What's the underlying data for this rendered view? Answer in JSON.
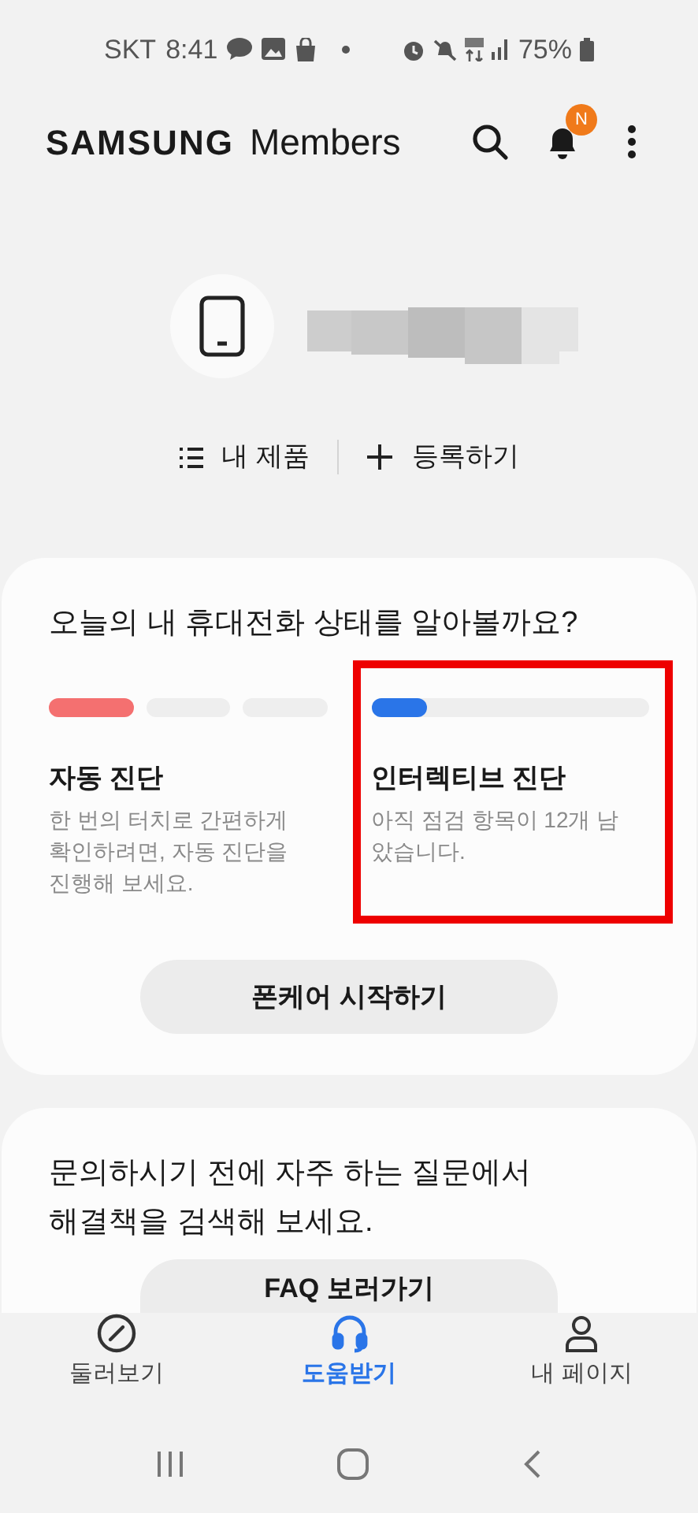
{
  "status_bar": {
    "carrier": "SKT",
    "time": "8:41",
    "battery": "75%"
  },
  "header": {
    "brand": "SAMSUNG",
    "title": "Members",
    "notification_badge": "N"
  },
  "profile_actions": [
    {
      "kind": "list",
      "label": "내 제품"
    },
    {
      "kind": "add",
      "label": "등록하기"
    }
  ],
  "diagnosis_card": {
    "question": "오늘의 내 휴대전화 상태를 알아볼까요?",
    "items": [
      {
        "kind": "segments",
        "title": "자동 진단",
        "description": "한 번의 터치로 간편하게 확인하려면, 자동 진단을 진행해 보세요.",
        "color": "#f47070",
        "segments": [
          {
            "done": true
          },
          {
            "done": false
          },
          {
            "done": false
          }
        ],
        "highlighted": false
      },
      {
        "kind": "bar",
        "title": "인터렉티브 진단",
        "description": "아직 점검 항목이 12개 남았습니다.",
        "color": "#2a75e8",
        "level": 0.2,
        "highlighted": true
      }
    ],
    "button": "폰케어 시작하기"
  },
  "faq_card": {
    "text": "문의하시기 전에 자주 하는 질문에서 해결책을 검색해 보세요.",
    "button": "FAQ 보러가기"
  },
  "bottom_nav": [
    {
      "kind": "explore",
      "label": "둘러보기",
      "selected": false
    },
    {
      "kind": "help",
      "label": "도움받기",
      "selected": true
    },
    {
      "kind": "profile",
      "label": "내 페이지",
      "selected": false
    }
  ]
}
